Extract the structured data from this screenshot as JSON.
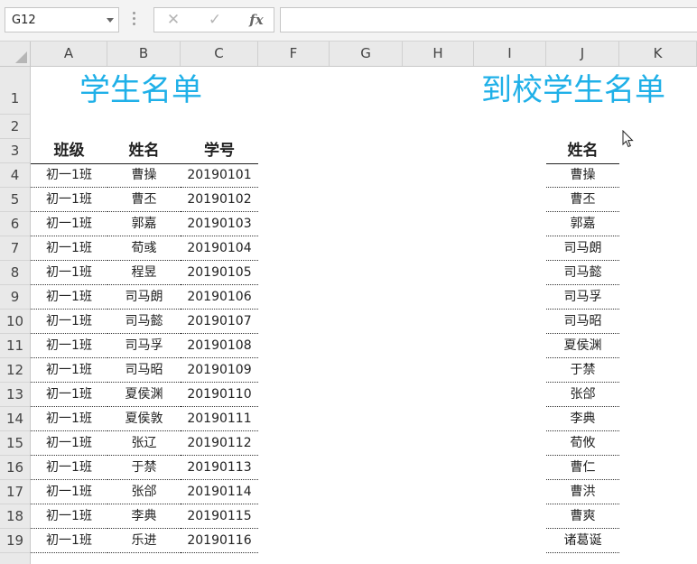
{
  "formula_bar": {
    "name_box": "G12",
    "cancel_glyph": "✕",
    "enter_glyph": "✓",
    "fx_label": "fx",
    "formula": ""
  },
  "columns": [
    "A",
    "B",
    "C",
    "F",
    "G",
    "H",
    "I",
    "J",
    "K"
  ],
  "rows": [
    "1",
    "2",
    "3",
    "4",
    "5",
    "6",
    "7",
    "8",
    "9",
    "10",
    "11",
    "12",
    "13",
    "14",
    "15",
    "16",
    "17",
    "18",
    "19"
  ],
  "sheet": {
    "title_left": "学生名单",
    "title_right": "到校学生名单",
    "headers": {
      "class": "班级",
      "name": "姓名",
      "id": "学号",
      "arrived_name": "姓名"
    },
    "students": [
      {
        "class": "初一1班",
        "name": "曹操",
        "id": "20190101"
      },
      {
        "class": "初一1班",
        "name": "曹丕",
        "id": "20190102"
      },
      {
        "class": "初一1班",
        "name": "郭嘉",
        "id": "20190103"
      },
      {
        "class": "初一1班",
        "name": "荀彧",
        "id": "20190104"
      },
      {
        "class": "初一1班",
        "name": "程昱",
        "id": "20190105"
      },
      {
        "class": "初一1班",
        "name": "司马朗",
        "id": "20190106"
      },
      {
        "class": "初一1班",
        "name": "司马懿",
        "id": "20190107"
      },
      {
        "class": "初一1班",
        "name": "司马孚",
        "id": "20190108"
      },
      {
        "class": "初一1班",
        "name": "司马昭",
        "id": "20190109"
      },
      {
        "class": "初一1班",
        "name": "夏侯渊",
        "id": "20190110"
      },
      {
        "class": "初一1班",
        "name": "夏侯敦",
        "id": "20190111"
      },
      {
        "class": "初一1班",
        "name": "张辽",
        "id": "20190112"
      },
      {
        "class": "初一1班",
        "name": "于禁",
        "id": "20190113"
      },
      {
        "class": "初一1班",
        "name": "张郃",
        "id": "20190114"
      },
      {
        "class": "初一1班",
        "name": "李典",
        "id": "20190115"
      },
      {
        "class": "初一1班",
        "name": "乐进",
        "id": "20190116"
      }
    ],
    "arrived": [
      "曹操",
      "曹丕",
      "郭嘉",
      "司马朗",
      "司马懿",
      "司马孚",
      "司马昭",
      "夏侯渊",
      "于禁",
      "张郃",
      "李典",
      "荀攸",
      "曹仁",
      "曹洪",
      "曹爽",
      "诸葛诞"
    ]
  },
  "colors": {
    "title": "#1fb0e8"
  }
}
